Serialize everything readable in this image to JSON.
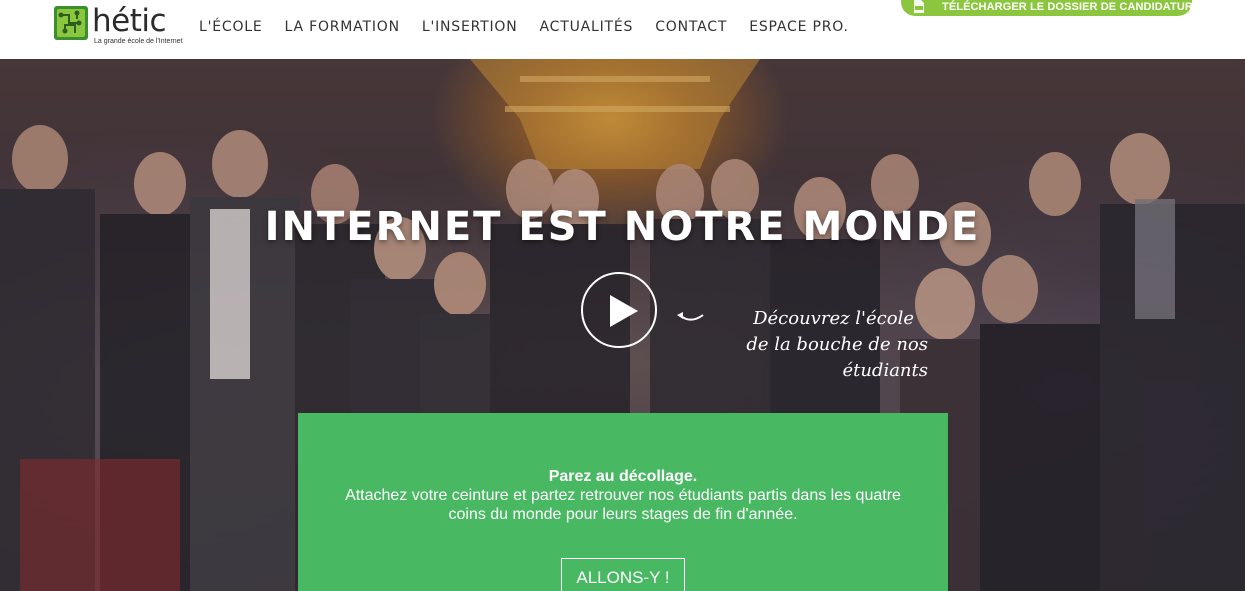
{
  "logo": {
    "name": "hétic",
    "tagline": "La grande école de l'Internet"
  },
  "nav": {
    "items": [
      {
        "label": "L'ÉCOLE"
      },
      {
        "label": "LA FORMATION"
      },
      {
        "label": "L'INSERTION"
      },
      {
        "label": "ACTUALITÉS"
      },
      {
        "label": "CONTACT"
      },
      {
        "label": "ESPACE PRO."
      }
    ]
  },
  "download": {
    "icon": "pdf-icon",
    "label": "TÉLÉCHARGER LE DOSSIER DE CANDIDATURE",
    "color": "#8cc63f"
  },
  "hero": {
    "title": "INTERNET EST NOTRE MONDE",
    "play_icon": "play-icon",
    "caption_line1": "Découvrez l'école",
    "caption_line2": "de la bouche de nos étudiants"
  },
  "promo": {
    "title": "Parez au décollage.",
    "text": "Attachez votre ceinture et partez retrouver nos étudiants partis dans les quatre coins du monde pour leurs stages de fin d'année.",
    "button_label": "ALLONS-Y !",
    "color": "#49b863"
  }
}
